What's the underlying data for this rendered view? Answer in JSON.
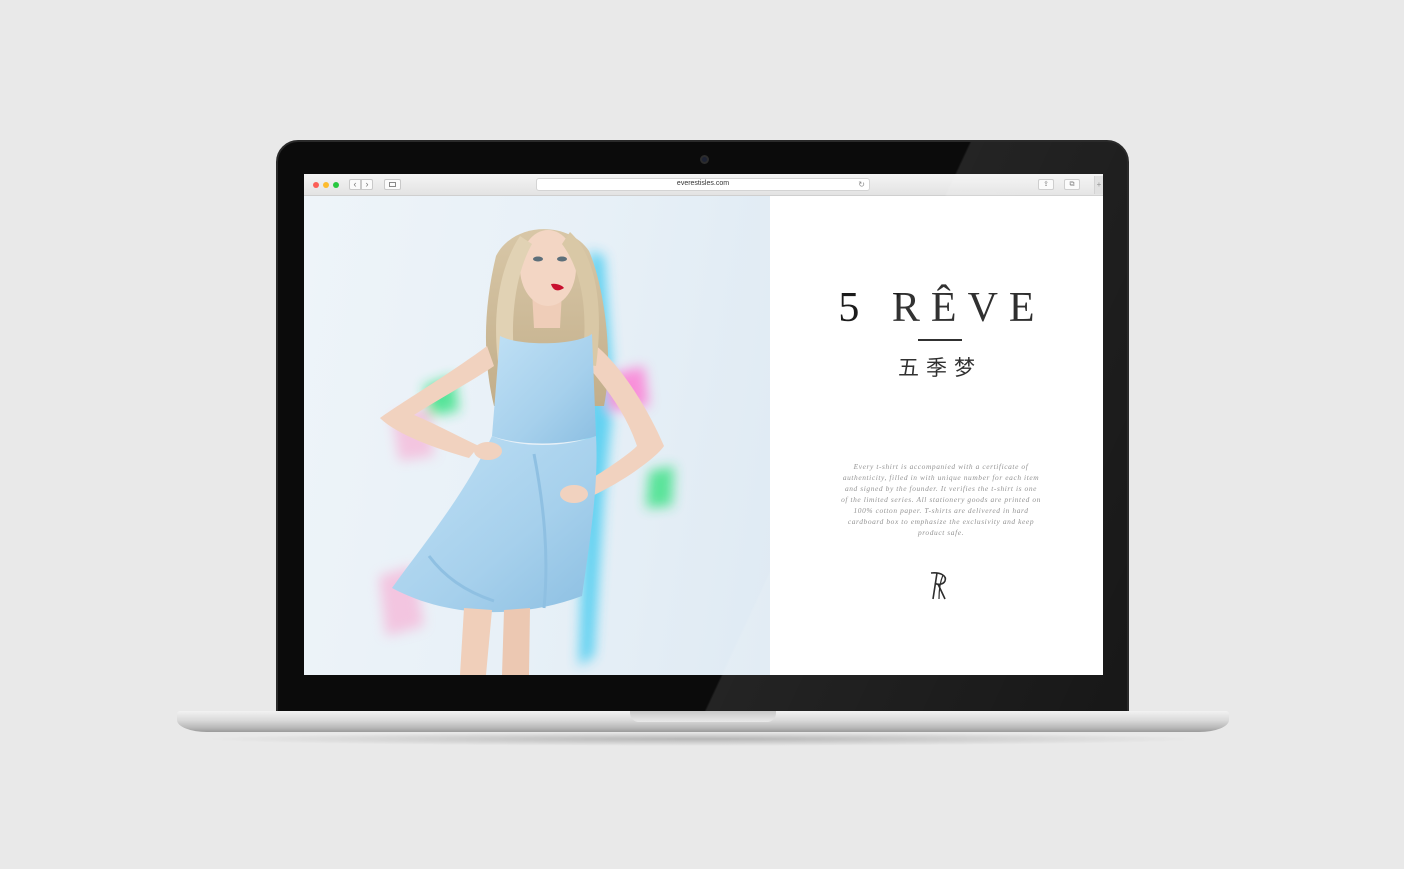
{
  "browser": {
    "url": "everestisles.com",
    "back_icon": "‹",
    "forward_icon": "›",
    "reload_icon": "↻",
    "share_icon": "⇪",
    "tabs_icon": "⧉",
    "newtab_icon": "+"
  },
  "hero": {
    "photo_description": "model-in-light-blue-dress"
  },
  "brand": {
    "title": "5 RÊVE",
    "subtitle_cn": "五季梦",
    "description": "Every t-shirt is accompanied with a certificate of authenticity, filled in with unique number for each item and signed by the founder. It verifies the t-shirt is one of the limited series. All stationery goods are printed on 100% cotton paper. T-shirts are delivered in hard cardboard box to emphasize the exclusivity and keep product safe."
  },
  "colors": {
    "background": "#e9e9e9",
    "bezel": "#0b0b0b",
    "dress": "#a9d3ee",
    "text": "#1b1b1b",
    "description_text": "#8a8a8a"
  }
}
